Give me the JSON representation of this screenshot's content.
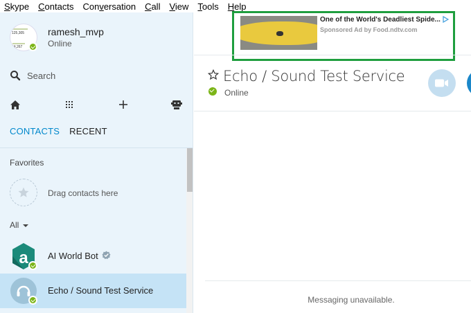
{
  "menu": [
    "Skype",
    "Contacts",
    "Conversation",
    "Call",
    "View",
    "Tools",
    "Help"
  ],
  "menu_mnemonics": [
    "S",
    "C",
    "v",
    "C",
    "V",
    "T",
    "H"
  ],
  "profile": {
    "name": "ramesh_mvp",
    "status": "Online",
    "avatar_stats": [
      "125,305",
      "64,267"
    ]
  },
  "search": {
    "placeholder": "Search"
  },
  "toolbar": {
    "icons": [
      "home-icon",
      "dialpad-icon",
      "add-icon",
      "bot-icon"
    ]
  },
  "tabs": {
    "contacts": "CONTACTS",
    "recent": "RECENT"
  },
  "favorites": {
    "label": "Favorites",
    "drag_text": "Drag contacts here"
  },
  "all_label": "All",
  "contacts": [
    {
      "name": "AI World Bot",
      "verified": true,
      "status": "online"
    },
    {
      "name": "Echo / Sound Test Service",
      "selected": true,
      "status": "online"
    }
  ],
  "ad": {
    "title": "One of the World's Deadliest Spide...",
    "sponsor": "Sponsored Ad by Food.ndtv.com"
  },
  "conversation": {
    "name": "Echo / Sound Test Service",
    "status": "Online"
  },
  "footer": {
    "message": "Messaging unavailable."
  },
  "colors": {
    "accent": "#0088cc",
    "online": "#7cb518",
    "sidebar_bg": "#eaf4fb",
    "selected_bg": "#c5e3f6",
    "ad_border": "#1e9e3e"
  }
}
